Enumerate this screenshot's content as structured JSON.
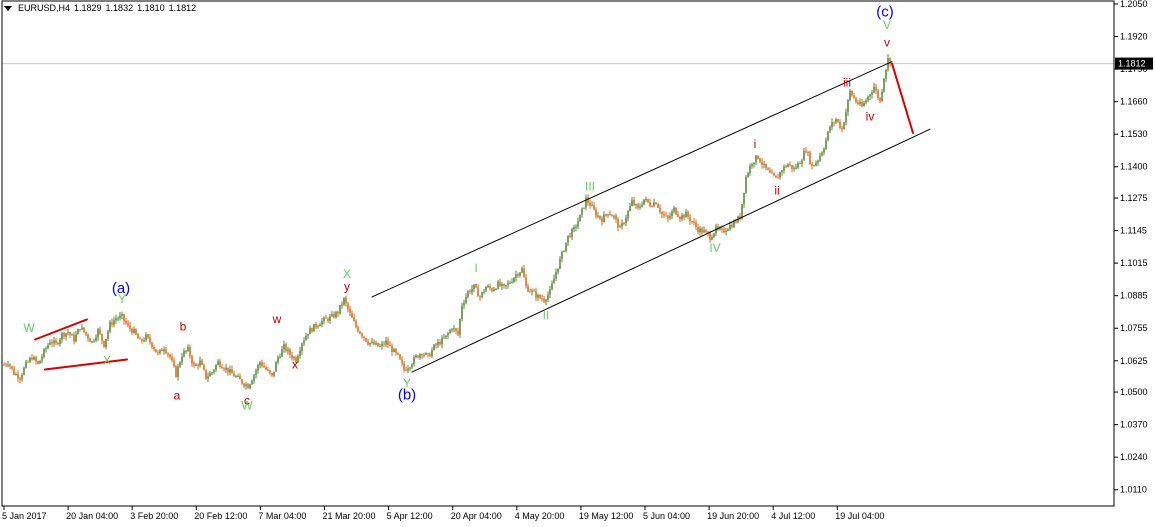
{
  "header": {
    "symbol": "EURUSD,H4",
    "open": "1.1829",
    "high": "1.1832",
    "low": "1.1810",
    "close": "1.1812"
  },
  "chart_data": {
    "type": "candlestick",
    "title": "",
    "grid": false,
    "ylim": [
      1.0045,
      1.2062
    ],
    "y_ticks": [
      "1.2050",
      "1.1920",
      "1.1790",
      "1.1660",
      "1.1530",
      "1.1400",
      "1.1275",
      "1.1145",
      "1.1015",
      "1.0885",
      "1.0755",
      "1.0625",
      "1.0500",
      "1.0370",
      "1.0240",
      "1.0110"
    ],
    "x_ticks": [
      "5 Jan 2017",
      "20 Jan 04:00",
      "3 Feb 20:00",
      "20 Feb 12:00",
      "7 Mar 04:00",
      "21 Mar 20:00",
      "5 Apr 12:00",
      "20 Apr 04:00",
      "4 May 20:00",
      "19 May 12:00",
      "5 Jun 04:00",
      "19 Jun 20:00",
      "4 Jul 12:00",
      "19 Jul 04:00"
    ],
    "current_price": "1.1812",
    "price_path": [
      [
        0,
        1.06
      ],
      [
        8,
        1.062
      ],
      [
        14,
        1.0575
      ],
      [
        20,
        1.056
      ],
      [
        26,
        1.061
      ],
      [
        32,
        1.064
      ],
      [
        38,
        1.061
      ],
      [
        44,
        1.066
      ],
      [
        50,
        1.0705
      ],
      [
        56,
        1.069
      ],
      [
        62,
        1.073
      ],
      [
        68,
        1.074
      ],
      [
        74,
        1.071
      ],
      [
        80,
        1.076
      ],
      [
        86,
        1.073
      ],
      [
        92,
        1.07
      ],
      [
        98,
        1.0745
      ],
      [
        104,
        1.069
      ],
      [
        110,
        1.077
      ],
      [
        116,
        1.0795
      ],
      [
        122,
        1.08
      ],
      [
        128,
        1.076
      ],
      [
        134,
        1.074
      ],
      [
        140,
        1.07
      ],
      [
        146,
        1.072
      ],
      [
        152,
        1.069
      ],
      [
        158,
        1.065
      ],
      [
        164,
        1.068
      ],
      [
        170,
        1.064
      ],
      [
        176,
        1.057
      ],
      [
        182,
        1.065
      ],
      [
        188,
        1.067
      ],
      [
        194,
        1.06
      ],
      [
        200,
        1.062
      ],
      [
        206,
        1.056
      ],
      [
        212,
        1.058
      ],
      [
        218,
        1.062
      ],
      [
        224,
        1.06
      ],
      [
        230,
        1.058
      ],
      [
        236,
        1.056
      ],
      [
        242,
        1.054
      ],
      [
        248,
        1.0525
      ],
      [
        254,
        1.057
      ],
      [
        260,
        1.062
      ],
      [
        266,
        1.059
      ],
      [
        272,
        1.056
      ],
      [
        278,
        1.064
      ],
      [
        284,
        1.068
      ],
      [
        290,
        1.065
      ],
      [
        296,
        1.063
      ],
      [
        302,
        1.07
      ],
      [
        308,
        1.074
      ],
      [
        314,
        1.076
      ],
      [
        320,
        1.078
      ],
      [
        326,
        1.079
      ],
      [
        332,
        1.08
      ],
      [
        338,
        1.082
      ],
      [
        344,
        1.087
      ],
      [
        350,
        1.081
      ],
      [
        356,
        1.076
      ],
      [
        362,
        1.073
      ],
      [
        368,
        1.07
      ],
      [
        374,
        1.069
      ],
      [
        380,
        1.068
      ],
      [
        386,
        1.07
      ],
      [
        392,
        1.067
      ],
      [
        398,
        1.064
      ],
      [
        404,
        1.059
      ],
      [
        410,
        1.061
      ],
      [
        416,
        1.064
      ],
      [
        422,
        1.066
      ],
      [
        428,
        1.064
      ],
      [
        434,
        1.068
      ],
      [
        440,
        1.07
      ],
      [
        446,
        1.072
      ],
      [
        452,
        1.076
      ],
      [
        458,
        1.073
      ],
      [
        462,
        1.085
      ],
      [
        468,
        1.09
      ],
      [
        474,
        1.092
      ],
      [
        480,
        1.088
      ],
      [
        486,
        1.092
      ],
      [
        492,
        1.091
      ],
      [
        498,
        1.093
      ],
      [
        504,
        1.0915
      ],
      [
        510,
        1.094
      ],
      [
        516,
        1.097
      ],
      [
        522,
        1.099
      ],
      [
        526,
        1.092
      ],
      [
        532,
        1.09
      ],
      [
        538,
        1.088
      ],
      [
        544,
        1.087
      ],
      [
        550,
        1.09
      ],
      [
        556,
        1.098
      ],
      [
        562,
        1.105
      ],
      [
        568,
        1.112
      ],
      [
        574,
        1.115
      ],
      [
        580,
        1.12
      ],
      [
        586,
        1.127
      ],
      [
        590,
        1.125
      ],
      [
        596,
        1.121
      ],
      [
        602,
        1.119
      ],
      [
        608,
        1.122
      ],
      [
        614,
        1.12
      ],
      [
        620,
        1.115
      ],
      [
        626,
        1.12
      ],
      [
        632,
        1.126
      ],
      [
        638,
        1.123
      ],
      [
        644,
        1.127
      ],
      [
        650,
        1.125
      ],
      [
        656,
        1.126
      ],
      [
        662,
        1.121
      ],
      [
        668,
        1.119
      ],
      [
        674,
        1.123
      ],
      [
        680,
        1.12
      ],
      [
        686,
        1.121
      ],
      [
        692,
        1.118
      ],
      [
        698,
        1.115
      ],
      [
        704,
        1.114
      ],
      [
        710,
        1.112
      ],
      [
        716,
        1.115
      ],
      [
        722,
        1.114
      ],
      [
        728,
        1.116
      ],
      [
        734,
        1.1175
      ],
      [
        740,
        1.12
      ],
      [
        746,
        1.136
      ],
      [
        752,
        1.142
      ],
      [
        758,
        1.144
      ],
      [
        764,
        1.14
      ],
      [
        770,
        1.137
      ],
      [
        776,
        1.135
      ],
      [
        782,
        1.139
      ],
      [
        788,
        1.141
      ],
      [
        794,
        1.139
      ],
      [
        800,
        1.142
      ],
      [
        806,
        1.147
      ],
      [
        812,
        1.14
      ],
      [
        818,
        1.143
      ],
      [
        824,
        1.148
      ],
      [
        830,
        1.156
      ],
      [
        836,
        1.159
      ],
      [
        842,
        1.155
      ],
      [
        846,
        1.162
      ],
      [
        850,
        1.17
      ],
      [
        856,
        1.166
      ],
      [
        862,
        1.164
      ],
      [
        868,
        1.168
      ],
      [
        874,
        1.172
      ],
      [
        880,
        1.166
      ],
      [
        884,
        1.176
      ],
      [
        888,
        1.1829
      ],
      [
        892,
        1.1812
      ]
    ],
    "annotations": [
      {
        "text": "(a)",
        "x": 121,
        "y": 1.0895,
        "color": "#0000ff",
        "size": 15
      },
      {
        "text": "(b)",
        "x": 407,
        "y": 1.047,
        "color": "#0000ff",
        "size": 15
      },
      {
        "text": "(c)",
        "x": 885,
        "y": 1.2,
        "color": "#0000ff",
        "size": 15
      },
      {
        "text": "W",
        "x": 29,
        "y": 1.074,
        "color": "#66cc66",
        "size": 12
      },
      {
        "text": "X",
        "x": 107,
        "y": 1.061,
        "color": "#66cc66",
        "size": 12
      },
      {
        "text": "Y",
        "x": 122,
        "y": 1.0855,
        "color": "#66cc66",
        "size": 12
      },
      {
        "text": "W",
        "x": 247,
        "y": 1.043,
        "color": "#66cc66",
        "size": 12
      },
      {
        "text": "X",
        "x": 347,
        "y": 1.0955,
        "color": "#66cc66",
        "size": 12
      },
      {
        "text": "Y",
        "x": 407,
        "y": 1.052,
        "color": "#66cc66",
        "size": 12
      },
      {
        "text": "I",
        "x": 476,
        "y": 1.098,
        "color": "#66cc66",
        "size": 12
      },
      {
        "text": "II",
        "x": 546,
        "y": 1.079,
        "color": "#66cc66",
        "size": 12
      },
      {
        "text": "III",
        "x": 590,
        "y": 1.1305,
        "color": "#66cc66",
        "size": 12
      },
      {
        "text": "IV",
        "x": 715,
        "y": 1.106,
        "color": "#66cc66",
        "size": 12
      },
      {
        "text": "V",
        "x": 887,
        "y": 1.195,
        "color": "#66cc66",
        "size": 12
      },
      {
        "text": "a",
        "x": 177,
        "y": 1.047,
        "color": "#cc0000",
        "size": 12
      },
      {
        "text": "b",
        "x": 183,
        "y": 1.0745,
        "color": "#cc0000",
        "size": 12
      },
      {
        "text": "c",
        "x": 247,
        "y": 1.045,
        "color": "#cc0000",
        "size": 12
      },
      {
        "text": "w",
        "x": 277,
        "y": 1.0775,
        "color": "#cc0000",
        "size": 12
      },
      {
        "text": "x",
        "x": 295,
        "y": 1.0595,
        "color": "#cc0000",
        "size": 12
      },
      {
        "text": "y",
        "x": 347,
        "y": 1.0905,
        "color": "#cc0000",
        "size": 12
      },
      {
        "text": "i",
        "x": 755,
        "y": 1.1475,
        "color": "#cc0000",
        "size": 12
      },
      {
        "text": "ii",
        "x": 777,
        "y": 1.129,
        "color": "#cc0000",
        "size": 12
      },
      {
        "text": "iii",
        "x": 847,
        "y": 1.172,
        "color": "#cc0000",
        "size": 12
      },
      {
        "text": "iv",
        "x": 870,
        "y": 1.1585,
        "color": "#cc0000",
        "size": 12
      },
      {
        "text": "v",
        "x": 887,
        "y": 1.188,
        "color": "#cc0000",
        "size": 12
      }
    ],
    "trendlines": [
      {
        "name": "channel-upper-line",
        "from": [
          372,
          1.088
        ],
        "to": [
          892,
          1.182
        ],
        "color": "#000000",
        "width": 1
      },
      {
        "name": "channel-lower-line",
        "from": [
          412,
          1.058
        ],
        "to": [
          930,
          1.155
        ],
        "color": "#000000",
        "width": 1
      },
      {
        "name": "triangle-upper-line",
        "from": [
          35,
          1.071
        ],
        "to": [
          87,
          1.079
        ],
        "color": "#dd0000",
        "width": 2
      },
      {
        "name": "triangle-lower-line",
        "from": [
          45,
          1.059
        ],
        "to": [
          127,
          1.063
        ],
        "color": "#dd0000",
        "width": 2
      },
      {
        "name": "projection-arrow-line",
        "from": [
          892,
          1.1812
        ],
        "to": [
          913,
          1.1535
        ],
        "color": "#dd0000",
        "width": 2
      }
    ],
    "colors": {
      "candle_up": "#5a8a3a",
      "candle_down": "#e06a1a",
      "axis": "#000000",
      "price_line": "#c8c8c8",
      "price_box_bg": "#000000",
      "price_box_fg": "#ffffff"
    }
  }
}
